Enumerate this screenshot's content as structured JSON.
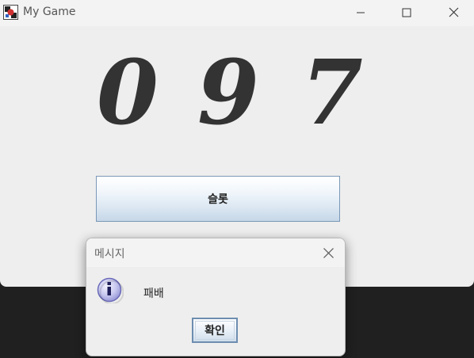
{
  "window": {
    "title": "My Game"
  },
  "slots": {
    "digits": [
      "0",
      "9",
      "7"
    ]
  },
  "slot_button": {
    "label": "슬롯"
  },
  "dialog": {
    "title": "메시지",
    "message": "패배",
    "ok_label": "확인"
  },
  "icons": {
    "app": "game-app-icon",
    "minimize": "minimize-icon",
    "maximize": "maximize-icon",
    "close": "close-icon",
    "dialog_close": "close-icon",
    "info": "info-icon"
  },
  "colors": {
    "digit": "#333333",
    "button_border": "#7a98b8",
    "info_icon": "#8080d0"
  }
}
